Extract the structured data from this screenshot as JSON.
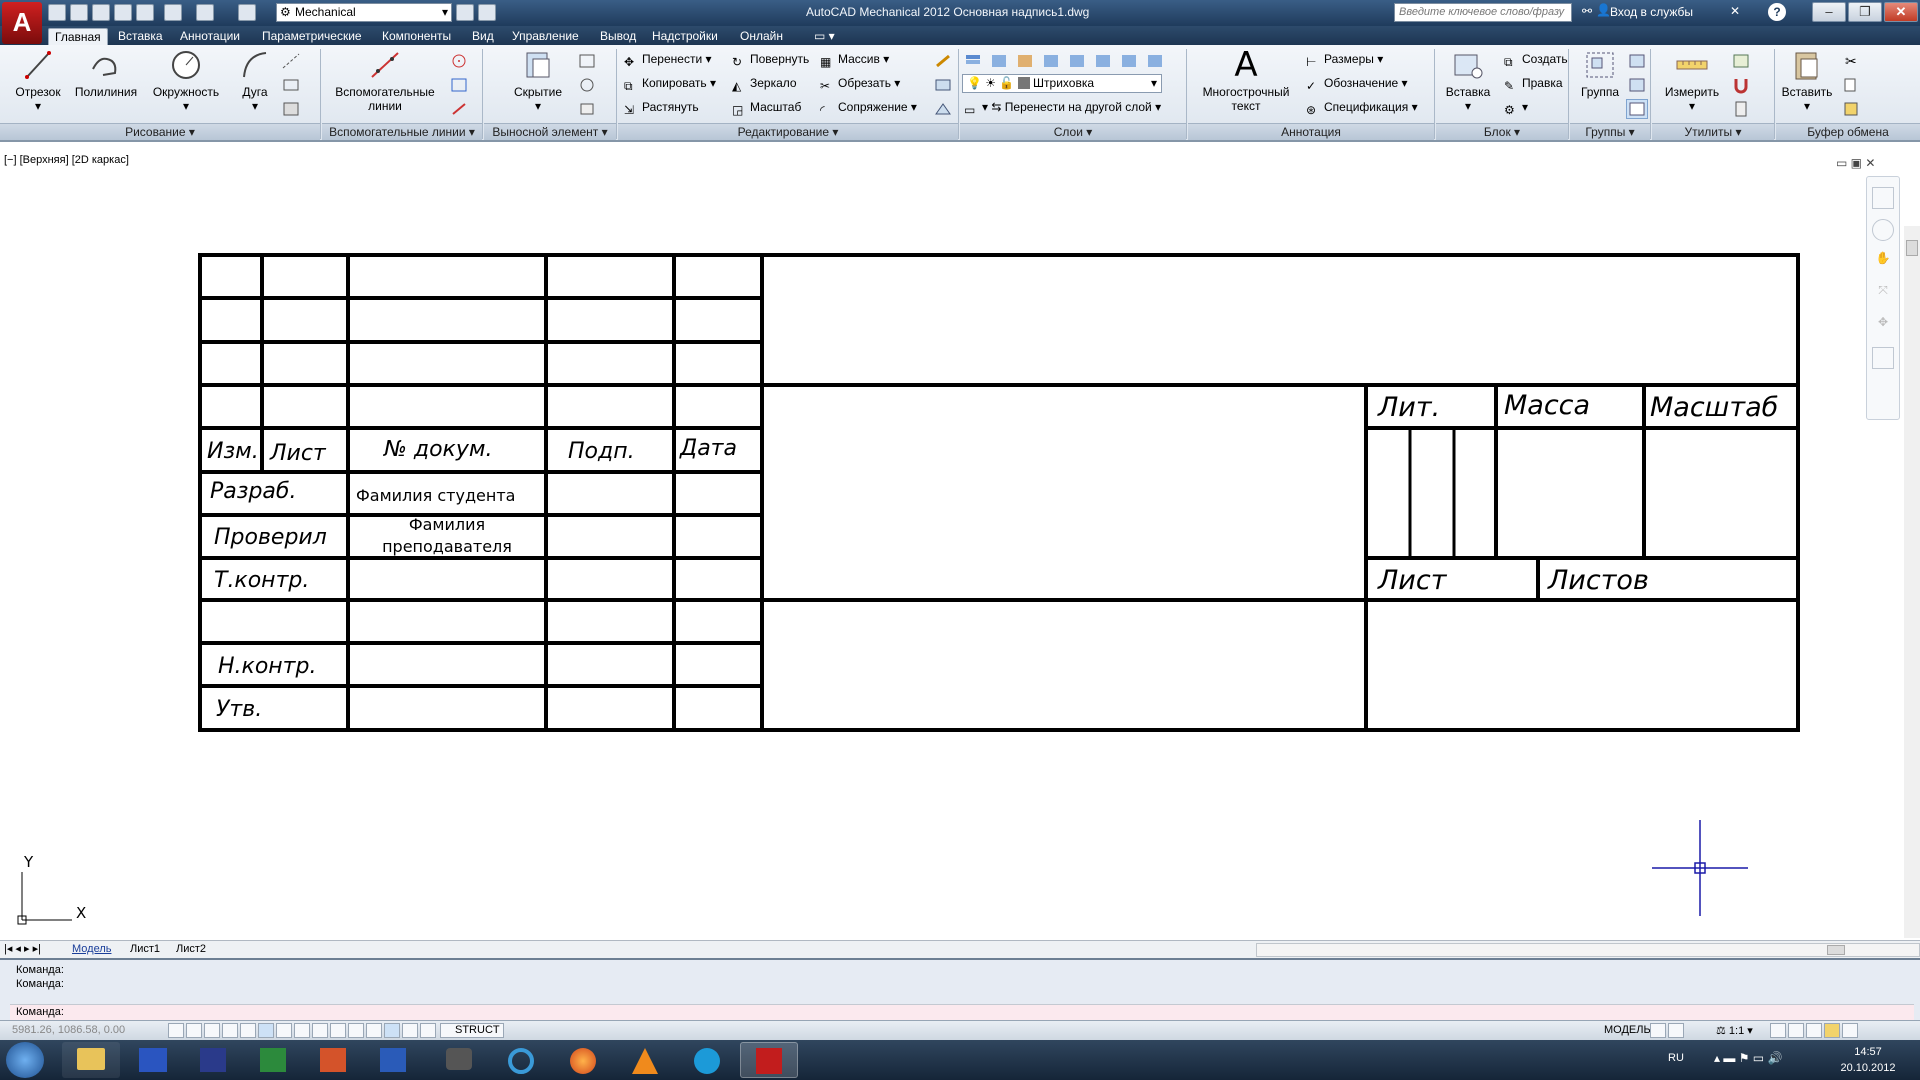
{
  "titlebar": {
    "app_button": "A",
    "app_sub": "M",
    "workspace": "Mechanical",
    "title": "AutoCAD Mechanical 2012    Основная надпись1.dwg",
    "search_placeholder": "Введите ключевое слово/фразу",
    "login": "Вход в службы",
    "help": "?"
  },
  "tabs": [
    "Главная",
    "Вставка",
    "Аннотации",
    "Параметрические",
    "Компоненты",
    "Вид",
    "Управление",
    "Вывод",
    "Надстройки",
    "Онлайн"
  ],
  "ribbon": {
    "draw": {
      "title": "Рисование ▾",
      "line": "Отрезок",
      "polyline": "Полилиния",
      "circle": "Окружность",
      "arc": "Дуга"
    },
    "construction": {
      "title": "Вспомогательные линии ▾",
      "label1": "Вспомогательные",
      "label2": "линии"
    },
    "detail": {
      "title": "Выносной элемент ▾",
      "hide": "Скрытие"
    },
    "modify": {
      "title": "Редактирование ▾",
      "move": "Перенести",
      "copy": "Копировать",
      "stretch": "Растянуть",
      "rotate": "Повернуть",
      "mirror": "Зеркало",
      "scale": "Масштаб",
      "array": "Массив",
      "trim": "Обрезать",
      "fillet": "Сопряжение"
    },
    "layers": {
      "title": "Слои ▾",
      "hatch_layer": "Штриховка",
      "move_to_layer": "Перенести на другой слой"
    },
    "annotation": {
      "title": "Аннотация",
      "mtext1": "Многострочный",
      "mtext2": "текст",
      "mtext_glyph": "A",
      "dimensions": "Размеры",
      "symbols": "Обозначение",
      "spec": "Спецификация"
    },
    "block": {
      "title": "Блок ▾",
      "insert": "Вставка",
      "create": "Создать",
      "edit": "Правка"
    },
    "groups": {
      "title": "Группы ▾",
      "group": "Группа"
    },
    "utilities": {
      "title": "Утилиты ▾",
      "measure": "Измерить"
    },
    "clipboard": {
      "title": "Буфер обмена",
      "paste": "Вставить"
    }
  },
  "viewport": {
    "label": "[−] [Верхняя] [2D каркас]",
    "controls": "▭ ▣ ✕",
    "axis_y": "Y",
    "axis_x": "X"
  },
  "title_block": {
    "izm": "Изм.",
    "list": "Лист",
    "doc_no": "№ докум.",
    "sign": "Подп.",
    "date": "Дата",
    "developer": "Разраб.",
    "checked": "Проверил",
    "tech_control": "Т.контр.",
    "norm_control": "Н.контр.",
    "approved": "Утв.",
    "student": "Фамилия студента",
    "teacher1": "Фамилия",
    "teacher2": "преподавателя",
    "lit": "Лит.",
    "mass": "Масса",
    "scale": "Масштаб",
    "sheet": "Лист",
    "sheets": "Листов"
  },
  "layout_tabs": {
    "model": "Модель",
    "sheet1": "Лист1",
    "sheet2": "Лист2"
  },
  "command": {
    "line1": "Команда:",
    "line2": "Команда:",
    "prompt": "Команда:"
  },
  "status": {
    "coords": "5981.26, 1086.58, 0.00",
    "struct": "STRUCT",
    "model": "МОДЕЛЬ",
    "scale": "1:1"
  },
  "taskbar": {
    "lang": "RU",
    "time": "14:57",
    "date": "20.10.2012"
  },
  "colors": {
    "title_bar": "#2a4a6e",
    "ribbon": "#e8edf3",
    "command_bg": "#e6ebf3",
    "cursor": "#1a1aa8",
    "taskbar": "#1c2e43"
  }
}
